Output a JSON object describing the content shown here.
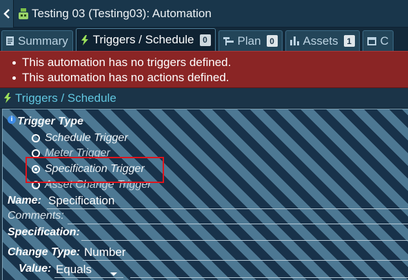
{
  "window": {
    "title": "Testing 03 (Testing03): Automation"
  },
  "tabs": [
    {
      "label": "Summary",
      "icon": "document-icon",
      "badge": ""
    },
    {
      "label": "Triggers / Schedule",
      "icon": "lightning-icon",
      "badge": "0",
      "active": true
    },
    {
      "label": "Plan",
      "icon": "plan-icon",
      "badge": "0"
    },
    {
      "label": "Assets",
      "icon": "bar-chart-icon",
      "badge": "1"
    },
    {
      "label": "C",
      "icon": "calendar-icon",
      "badge": ""
    }
  ],
  "alerts": [
    "This automation has no triggers defined.",
    "This automation has no actions defined."
  ],
  "section": {
    "title": "Triggers / Schedule"
  },
  "trigger_type": {
    "label": "Trigger Type",
    "options": [
      {
        "label": "Schedule Trigger",
        "checked": false
      },
      {
        "label": "Meter Trigger",
        "checked": false
      },
      {
        "label": "Specification Trigger",
        "checked": true
      },
      {
        "label": "Asset Change Trigger",
        "checked": false
      }
    ]
  },
  "fields": {
    "name_label": "Name:",
    "name_value": "Specification",
    "comments_label": "Comments:",
    "comments_value": "",
    "specification_label": "Specification:",
    "specification_value": "",
    "change_type_label": "Change Type:",
    "change_type_value": "Number",
    "value_label": "Value:",
    "value_value": "Equals"
  },
  "colors": {
    "alert_background": "#8a2525",
    "accent": "#61c7e0",
    "highlight": "#e0141c"
  }
}
